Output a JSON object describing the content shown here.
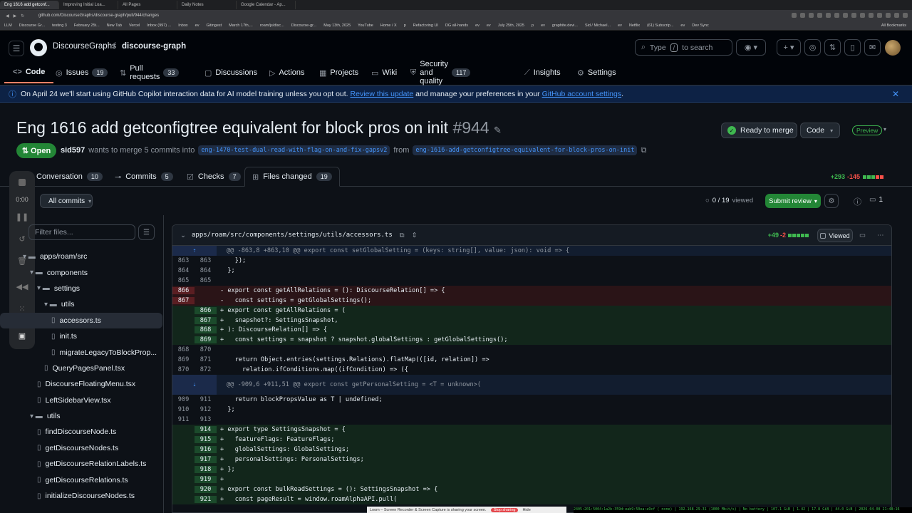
{
  "browser": {
    "tabs": [
      "Eng 1616 add getconf...",
      "Improving Initial Loa...",
      "All Pages",
      "Daily Notes",
      "Google Calendar - Ap..."
    ],
    "url": "github.com/DiscourseGraphs/discourse-graph/pull/944/changes",
    "bookmarks": [
      "LLM",
      "Discourse Gr...",
      "testing 3",
      "February 25t...",
      "New Tab",
      "Vercel",
      "Inbox (997) ...",
      "Inbox",
      "ev",
      "Gitingest",
      "March 17th,...",
      "roam/js/disc...",
      "Discourse-gr...",
      "May 13th, 2025",
      "YouTube",
      "Home / X",
      "p",
      "Refactoring UI",
      "DG all-hands",
      "ev",
      "ev",
      "July 25th, 2025",
      "p",
      "ev",
      "graphite.devi...",
      "Sid / Michael...",
      "ev",
      "Netflix",
      "(61) Subscrip...",
      "ev",
      "Dev Sync",
      "All Bookmarks"
    ]
  },
  "header": {
    "owner": "DiscourseGraphs",
    "separator": "/",
    "repo": "discourse-graph",
    "search_prefix": "Type",
    "search_key": "/",
    "search_suffix": "to search"
  },
  "repo_nav": [
    {
      "label": "Code",
      "icon": "<>",
      "count": ""
    },
    {
      "label": "Issues",
      "icon": "◎",
      "count": "19"
    },
    {
      "label": "Pull requests",
      "icon": "⇅",
      "count": "33"
    },
    {
      "label": "Discussions",
      "icon": "▢",
      "count": ""
    },
    {
      "label": "Actions",
      "icon": "▷",
      "count": ""
    },
    {
      "label": "Projects",
      "icon": "▦",
      "count": ""
    },
    {
      "label": "Wiki",
      "icon": "▭",
      "count": ""
    },
    {
      "label": "Security and quality",
      "icon": "⛨",
      "count": "117"
    },
    {
      "label": "Insights",
      "icon": "⟋",
      "count": ""
    },
    {
      "label": "Settings",
      "icon": "⚙",
      "count": ""
    }
  ],
  "banner": {
    "text1": "On April 24 we'll start using GitHub Copilot interaction data for AI model training unless you opt out.",
    "link1": "Review this update",
    "text2": "and manage your preferences in your",
    "link2": "GitHub account settings",
    "text3": "."
  },
  "pr": {
    "title": "Eng 1616 add getconfigtree equivalent for block pros on init",
    "number": "#944",
    "state": "Open",
    "author": "sid597",
    "merge_text": "wants to merge 5 commits into",
    "base_branch": "eng-1470-test-dual-read-with-flag-on-and-fix-gapsv2",
    "from": "from",
    "head_branch": "eng-1616-add-getconfigtree-equivalent-for-block-pros-on-init",
    "ready_label": "Ready to merge",
    "code_label": "Code",
    "preview_label": "Preview"
  },
  "pr_tabs": [
    {
      "label": "Conversation",
      "count": "10"
    },
    {
      "label": "Commits",
      "count": "5"
    },
    {
      "label": "Checks",
      "count": "7"
    },
    {
      "label": "Files changed",
      "count": "19"
    }
  ],
  "diffstat": {
    "additions": "+293",
    "deletions": "-145"
  },
  "toolbar": {
    "all_commits": "All commits",
    "viewed_count": "0 / 19",
    "viewed_label": "viewed",
    "submit_review": "Submit review",
    "comments_count": "1"
  },
  "loom": {
    "timer": "0:00"
  },
  "filetree": {
    "filter_placeholder": "Filter files...",
    "items": [
      {
        "label": "apps/roam/src",
        "type": "folder",
        "indent": 0
      },
      {
        "label": "components",
        "type": "folder",
        "indent": 1
      },
      {
        "label": "settings",
        "type": "folder",
        "indent": 2
      },
      {
        "label": "utils",
        "type": "folder",
        "indent": 3
      },
      {
        "label": "accessors.ts",
        "type": "file",
        "indent": 4
      },
      {
        "label": "init.ts",
        "type": "file",
        "indent": 4
      },
      {
        "label": "migrateLegacyToBlockProp...",
        "type": "file",
        "indent": 4
      },
      {
        "label": "QueryPagesPanel.tsx",
        "type": "file",
        "indent": 3
      },
      {
        "label": "DiscourseFloatingMenu.tsx",
        "type": "file",
        "indent": 2
      },
      {
        "label": "LeftSidebarView.tsx",
        "type": "file",
        "indent": 2
      },
      {
        "label": "utils",
        "type": "folder",
        "indent": 1
      },
      {
        "label": "findDiscourseNode.ts",
        "type": "file",
        "indent": 2
      },
      {
        "label": "getDiscourseNodes.ts",
        "type": "file",
        "indent": 2
      },
      {
        "label": "getDiscourseRelationLabels.ts",
        "type": "file",
        "indent": 2
      },
      {
        "label": "getDiscourseRelations.ts",
        "type": "file",
        "indent": 2
      },
      {
        "label": "initializeDiscourseNodes.ts",
        "type": "file",
        "indent": 2
      }
    ]
  },
  "diff_file": {
    "path": "apps/roam/src/components/settings/utils/accessors.ts",
    "additions": "+49",
    "deletions": "-2",
    "viewed_label": "Viewed",
    "lines": [
      {
        "t": "hunk",
        "o": "",
        "n": "",
        "c": "@@ -863,8 +863,10 @@ export const setGlobalSetting = (keys: string[], value: json): void => {"
      },
      {
        "t": "ctx",
        "o": "863",
        "n": "863",
        "c": "    });"
      },
      {
        "t": "ctx",
        "o": "864",
        "n": "864",
        "c": "  };"
      },
      {
        "t": "ctx",
        "o": "865",
        "n": "865",
        "c": ""
      },
      {
        "t": "del",
        "o": "866",
        "n": "",
        "c": "- export const getAllRelations = (): DiscourseRelation[] => {"
      },
      {
        "t": "del",
        "o": "867",
        "n": "",
        "c": "-   const settings = getGlobalSettings();"
      },
      {
        "t": "add",
        "o": "",
        "n": "866",
        "c": "+ export const getAllRelations = ("
      },
      {
        "t": "add",
        "o": "",
        "n": "867",
        "c": "+   snapshot?: SettingsSnapshot,"
      },
      {
        "t": "add",
        "o": "",
        "n": "868",
        "c": "+ ): DiscourseRelation[] => {"
      },
      {
        "t": "add",
        "o": "",
        "n": "869",
        "c": "+   const settings = snapshot ? snapshot.globalSettings : getGlobalSettings();"
      },
      {
        "t": "ctx",
        "o": "868",
        "n": "870",
        "c": ""
      },
      {
        "t": "ctx",
        "o": "869",
        "n": "871",
        "c": "    return Object.entries(settings.Relations).flatMap(([id, relation]) =>"
      },
      {
        "t": "ctx",
        "o": "870",
        "n": "872",
        "c": "      relation.ifConditions.map((ifCondition) => ({"
      },
      {
        "t": "hunk2",
        "o": "",
        "n": "",
        "c": "@@ -909,6 +911,51 @@ export const getPersonalSetting = <T = unknown>("
      },
      {
        "t": "ctx",
        "o": "909",
        "n": "911",
        "c": "    return blockPropsValue as T | undefined;"
      },
      {
        "t": "ctx",
        "o": "910",
        "n": "912",
        "c": "  };"
      },
      {
        "t": "ctx",
        "o": "911",
        "n": "913",
        "c": ""
      },
      {
        "t": "add",
        "o": "",
        "n": "914",
        "c": "+ export type SettingsSnapshot = {"
      },
      {
        "t": "add",
        "o": "",
        "n": "915",
        "c": "+   featureFlags: FeatureFlags;"
      },
      {
        "t": "add",
        "o": "",
        "n": "916",
        "c": "+   globalSettings: GlobalSettings;"
      },
      {
        "t": "add",
        "o": "",
        "n": "917",
        "c": "+   personalSettings: PersonalSettings;"
      },
      {
        "t": "add",
        "o": "",
        "n": "918",
        "c": "+ };"
      },
      {
        "t": "add",
        "o": "",
        "n": "919",
        "c": "+"
      },
      {
        "t": "add",
        "o": "",
        "n": "920",
        "c": "+ export const bulkReadSettings = (): SettingsSnapshot => {"
      },
      {
        "t": "add",
        "o": "",
        "n": "921",
        "c": "+   const pageResult = window.roamAlphaAPI.pull("
      }
    ]
  },
  "loombar": {
    "text": "Loom – Screen Recorder & Screen Capture is sharing your screen.",
    "stop": "Stop sharing",
    "hide": "Hide"
  },
  "statusbar": "2405:201:5004:1a2b:359d:eab9:50ea:a9cf (  none) | 192.168.29.31 (1000 Mbit/s) | No battery | 107.1 GiB | 1.42 | 17.8 GiB | 44.0 GiB | 2026-04-08 21:48:16",
  "colors": {
    "accent_blue": "#4493f8",
    "green": "#3fb950",
    "red": "#f85149",
    "open_green": "#238636"
  }
}
